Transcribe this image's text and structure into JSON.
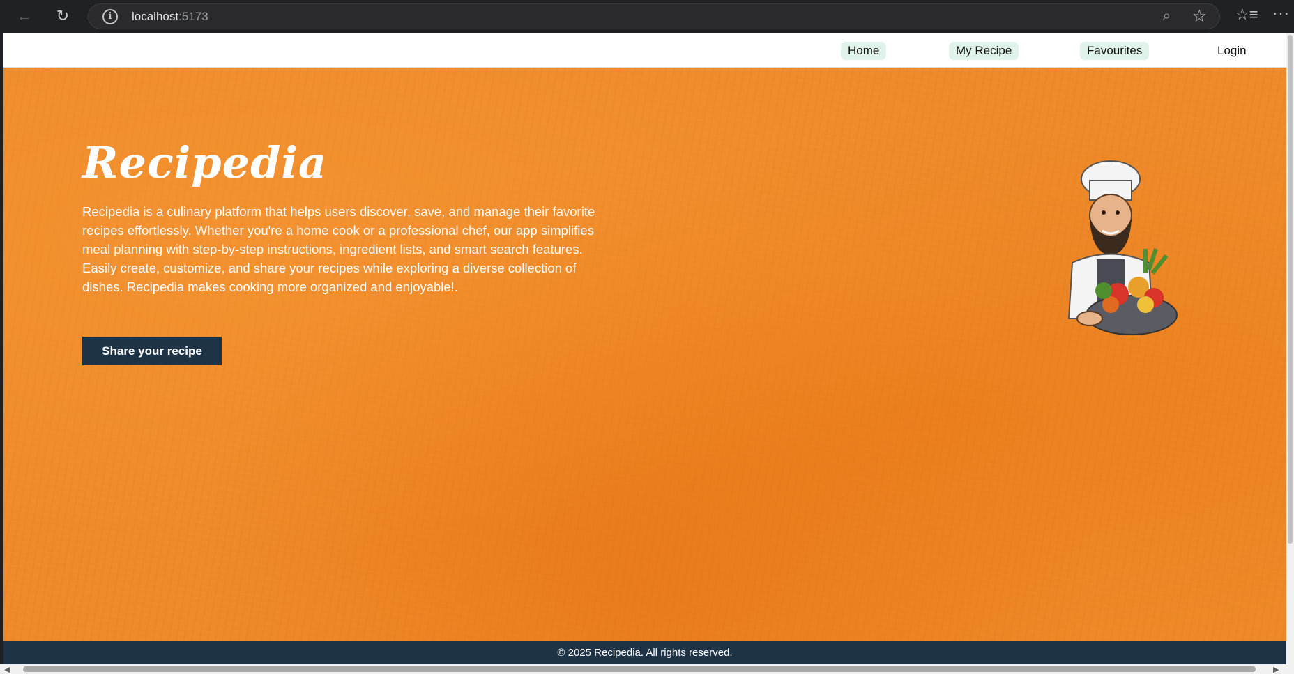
{
  "browser": {
    "url_host": "localhost",
    "url_port": ":5173"
  },
  "navbar": {
    "items": [
      {
        "label": "Home"
      },
      {
        "label": "My Recipe"
      },
      {
        "label": "Favourites"
      },
      {
        "label": "Login"
      }
    ]
  },
  "hero": {
    "title": "Recipedia",
    "description": "Recipedia is a culinary platform that helps users discover, save, and manage their favorite recipes effortlessly. Whether you're a home cook or a professional chef, our app simplifies meal planning with step-by-step instructions, ingredient lists, and smart search features. Easily create, customize, and share your recipes while exploring a diverse collection of dishes. Recipedia makes cooking more organized and enjoyable!.",
    "share_button": "Share your recipe",
    "illustration": "chef-with-vegetables"
  },
  "footer": {
    "text": "© 2025 Recipedia. All rights reserved."
  },
  "colors": {
    "hero_bg": "#ee8a2a",
    "nav_pill": "#dff3ea",
    "dark_navy": "#1f3347"
  }
}
